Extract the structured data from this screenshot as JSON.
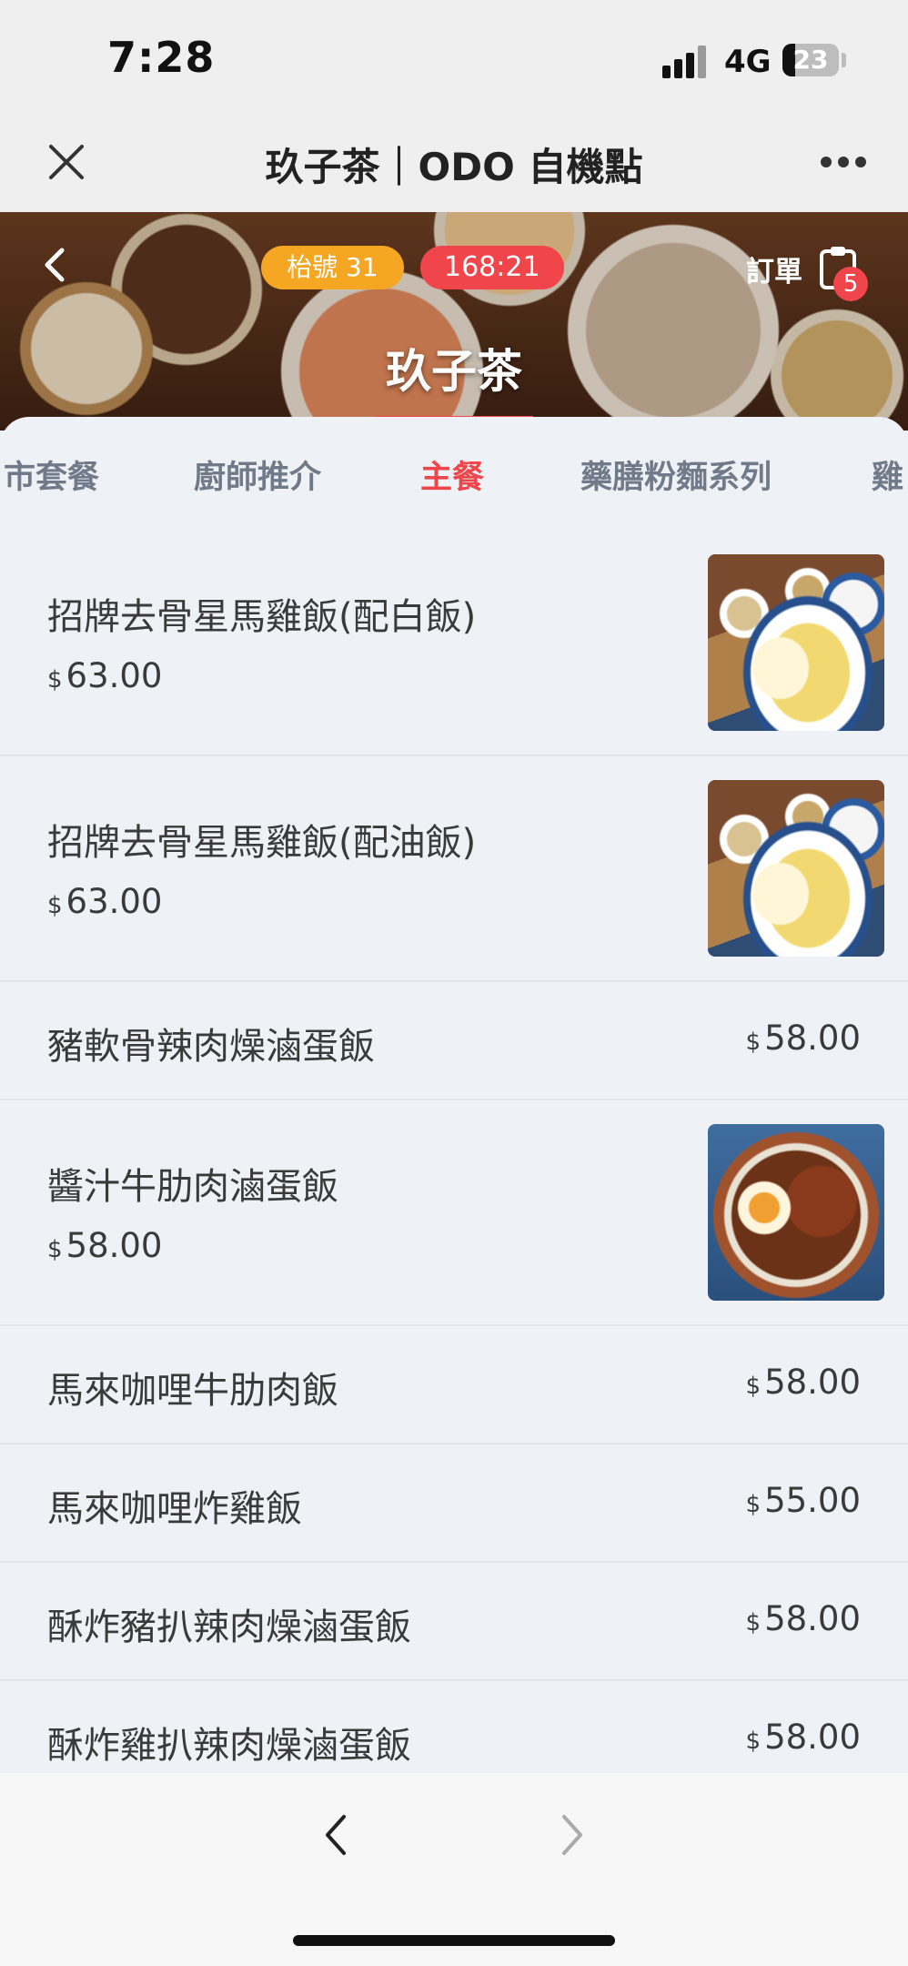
{
  "status_bar": {
    "time": "7:28",
    "network": "4G",
    "battery": "23",
    "battery_level": 0.23
  },
  "nav_bar": {
    "close_icon": "close-icon",
    "title": "玖子茶｜ODO 自機點",
    "more_icon": "more-dots-icon"
  },
  "hero": {
    "back_icon": "chevron-left-icon",
    "table_badge": "枱號 31",
    "timer_badge": "168:21",
    "order_label": "訂單",
    "order_icon": "clipboard-icon",
    "order_count": "5",
    "store_name": "玖子茶",
    "colors": {
      "accent": "#f0454a",
      "table_badge": "#f5a623"
    }
  },
  "tabs": [
    {
      "label": "市套餐",
      "active": false
    },
    {
      "label": "廚師推介",
      "active": false
    },
    {
      "label": "主餐",
      "active": true
    },
    {
      "label": "藥膳粉麵系列",
      "active": false
    },
    {
      "label": "雞",
      "active": false
    }
  ],
  "menu": {
    "currency": "$",
    "items": [
      {
        "name": "招牌去骨星馬雞飯(配白飯)",
        "price": "63.00",
        "image": "hainanese-chicken-rice"
      },
      {
        "name": "招牌去骨星馬雞飯(配油飯)",
        "price": "63.00",
        "image": "hainanese-chicken-rice"
      },
      {
        "name": "豬軟骨辣肉燥滷蛋飯",
        "price": "58.00"
      },
      {
        "name": "醬汁牛肋肉滷蛋飯",
        "price": "58.00",
        "image": "beef-rib-braised-egg-rice"
      },
      {
        "name": "馬來咖哩牛肋肉飯",
        "price": "58.00"
      },
      {
        "name": "馬來咖哩炸雞飯",
        "price": "55.00"
      },
      {
        "name": "酥炸豬扒辣肉燥滷蛋飯",
        "price": "58.00"
      },
      {
        "name": "酥炸雞扒辣肉燥滷蛋飯",
        "price": "58.00"
      }
    ]
  },
  "bottom_bar": {
    "prev_icon": "chevron-left-icon",
    "next_icon": "chevron-right-icon"
  }
}
